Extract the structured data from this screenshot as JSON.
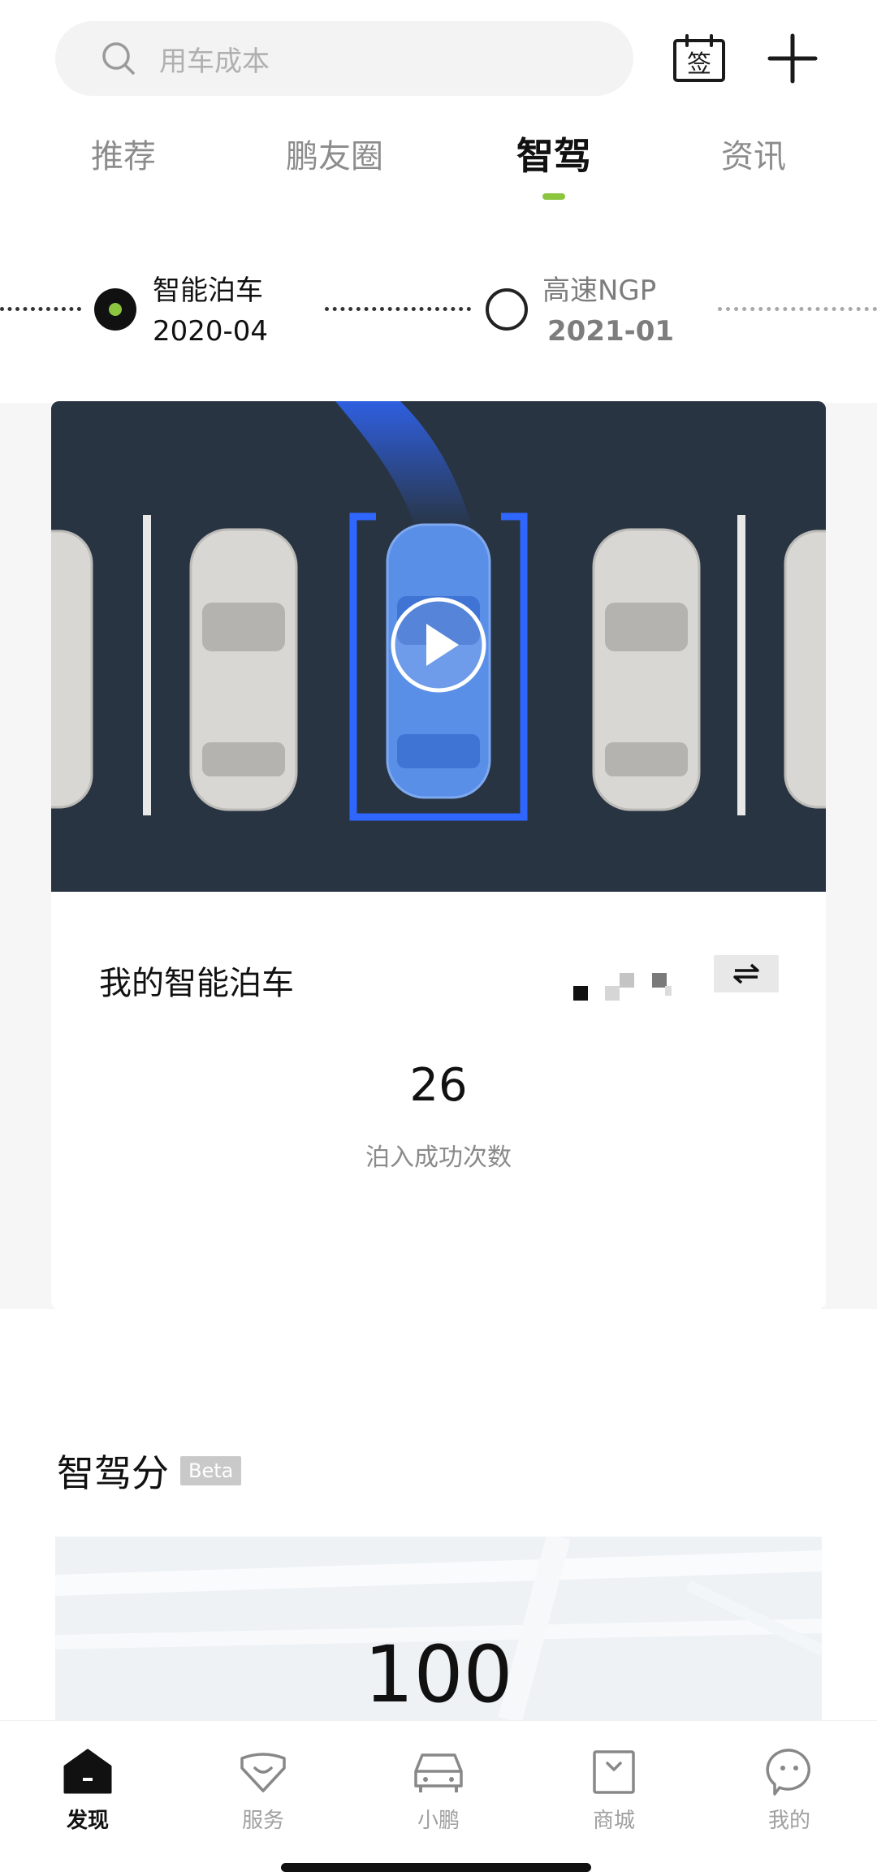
{
  "search": {
    "placeholder": "用车成本",
    "icon": "search-icon"
  },
  "header": {
    "checkin_icon": "calendar-checkin-icon",
    "checkin_glyph": "签",
    "add_icon": "plus-icon"
  },
  "tabs": [
    {
      "label": "推荐",
      "active": false
    },
    {
      "label": "鹏友圈",
      "active": false
    },
    {
      "label": "智驾",
      "active": true
    },
    {
      "label": "资讯",
      "active": false
    }
  ],
  "accent_color": "#8cc63f",
  "timeline": [
    {
      "title": "智能泊车",
      "date": "2020-04",
      "active": true
    },
    {
      "title": "高速NGP",
      "date": "2021-01",
      "active": false
    }
  ],
  "parking_card": {
    "title": "我的智能泊车",
    "stat_value": "26",
    "stat_label": "泊入成功次数",
    "play_icon": "play-icon",
    "swap_icon": "swap-icon"
  },
  "score": {
    "title": "智驾分",
    "badge": "Beta",
    "value": "100"
  },
  "bottom_nav": [
    {
      "label": "发现",
      "icon": "home-icon",
      "active": true
    },
    {
      "label": "服务",
      "icon": "service-icon",
      "active": false
    },
    {
      "label": "小鹏",
      "icon": "car-icon",
      "active": false
    },
    {
      "label": "商城",
      "icon": "shopping-bag-icon",
      "active": false
    },
    {
      "label": "我的",
      "icon": "chat-face-icon",
      "active": false
    }
  ]
}
